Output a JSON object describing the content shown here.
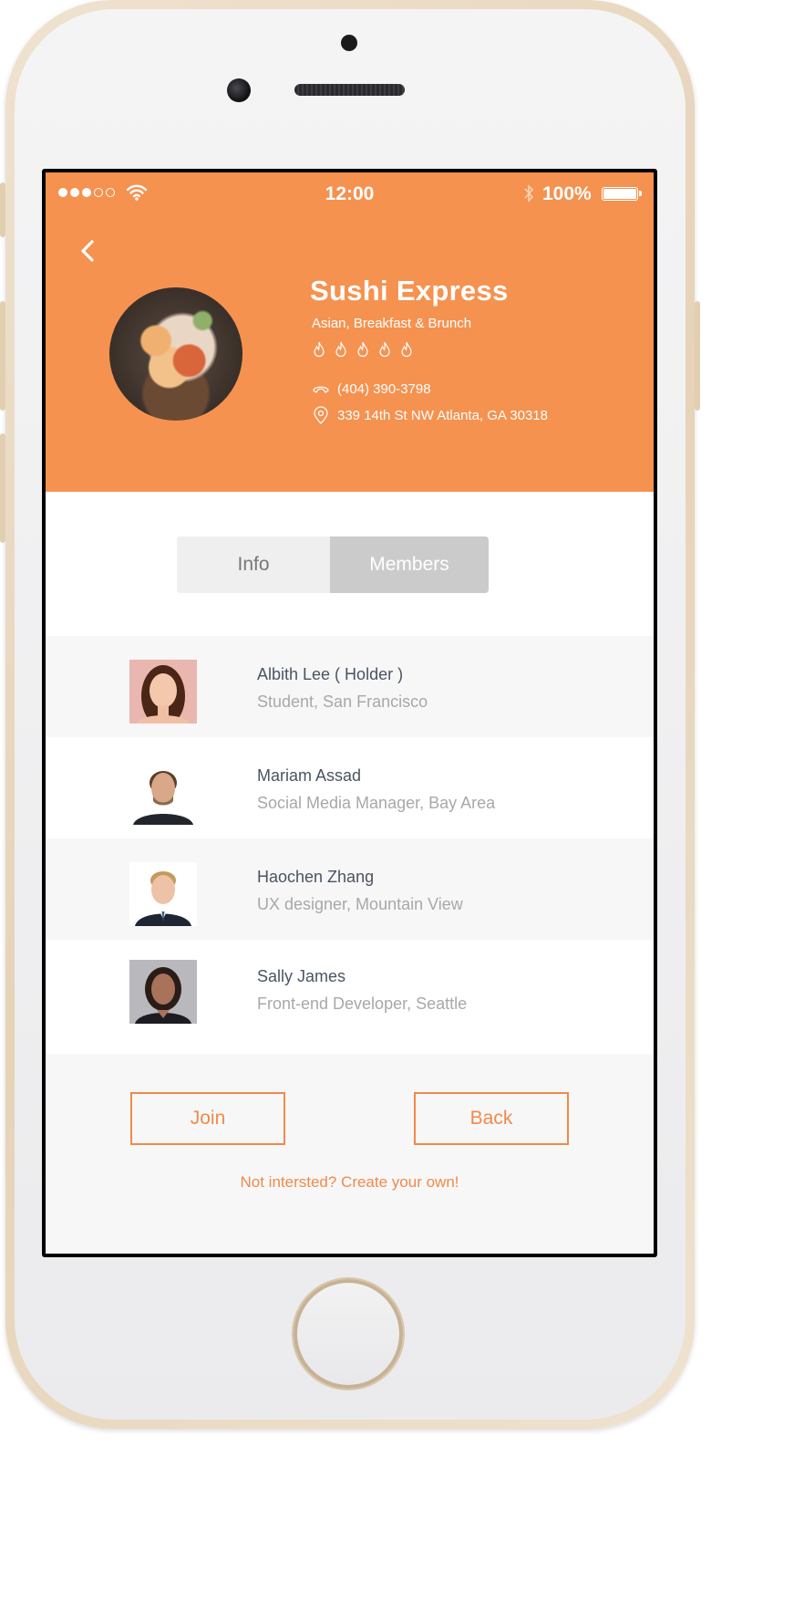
{
  "status_bar": {
    "time": "12:00",
    "battery": "100%"
  },
  "restaurant": {
    "name": "Sushi Express",
    "cuisine": "Asian, Breakfast & Brunch",
    "phone": "(404) 390-3798",
    "address": "339 14th St NW Atlanta, GA 30318",
    "spice_level": {
      "value": 0,
      "max": 5
    }
  },
  "tabs": [
    {
      "label": "Info",
      "selected": false
    },
    {
      "label": "Members",
      "selected": true
    }
  ],
  "members": [
    {
      "name": "Albith Lee ( Holder )",
      "role": "Student, San Francisco"
    },
    {
      "name": "Mariam Assad",
      "role": "Social Media Manager, Bay Area"
    },
    {
      "name": "Haochen Zhang",
      "role": "UX designer, Mountain View"
    },
    {
      "name": "Sally James",
      "role": "Front-end Developer, Seattle"
    }
  ],
  "actions": {
    "join_label": "Join",
    "back_label": "Back",
    "create_link": "Not intersted? Create your own!"
  },
  "colors": {
    "accent": "#f59250",
    "button_accent": "#f08a4b",
    "name_text": "#4a5461",
    "sub_text": "#a8a8a8"
  },
  "icons": [
    "back-chevron-icon",
    "flame-icon",
    "phone-icon",
    "location-pin-icon",
    "wifi-icon",
    "bluetooth-icon",
    "battery-icon"
  ]
}
